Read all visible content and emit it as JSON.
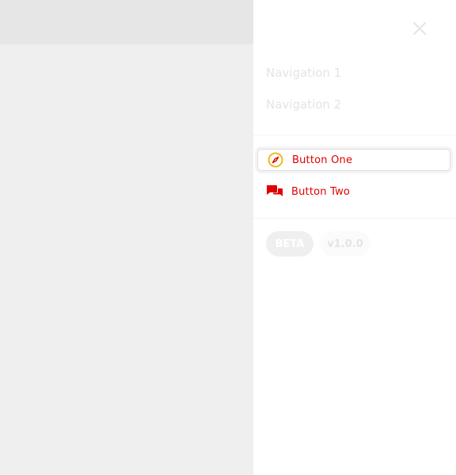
{
  "drawer": {
    "close_icon": "close-icon",
    "nav": [
      {
        "label": "Navigation 1"
      },
      {
        "label": "Navigation 2"
      }
    ],
    "actions": [
      {
        "label": "Button One",
        "icon": "compass-icon"
      },
      {
        "label": "Button Two",
        "icon": "chat-icon"
      }
    ],
    "badges": {
      "beta": "BETA",
      "version": "v1.0.0"
    }
  },
  "colors": {
    "accent_red": "#e00000",
    "accent_yellow": "#f0b400",
    "muted_text": "#e4e4e4",
    "backdrop": "#efefef"
  }
}
